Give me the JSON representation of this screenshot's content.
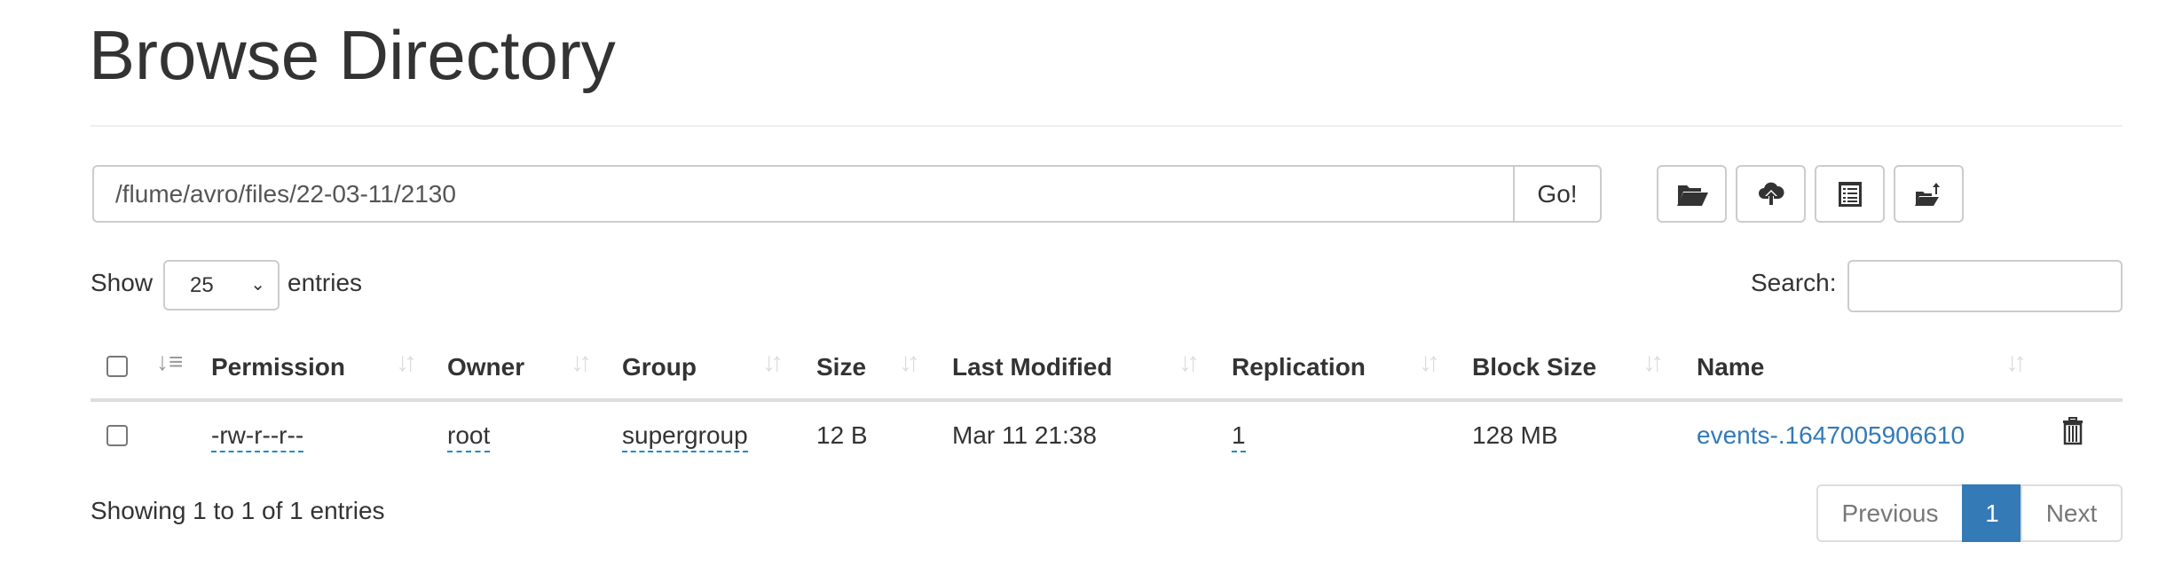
{
  "page_title": "Browse Directory",
  "path": {
    "value": "/flume/avro/files/22-03-11/2130",
    "go_label": "Go!"
  },
  "toolbar": {
    "icons": [
      "folder-open-icon",
      "cloud-upload-icon",
      "list-alt-icon",
      "folder-upload-icon"
    ]
  },
  "length": {
    "show_label": "Show",
    "selected": "25",
    "entries_label": "entries"
  },
  "search": {
    "label": "Search:",
    "value": ""
  },
  "table": {
    "headers": [
      "Permission",
      "Owner",
      "Group",
      "Size",
      "Last Modified",
      "Replication",
      "Block Size",
      "Name"
    ],
    "rows": [
      {
        "permission": "-rw-r--r--",
        "owner": "root",
        "group": "supergroup",
        "size": "12 B",
        "last_modified": "Mar 11 21:38",
        "replication": "1",
        "block_size": "128 MB",
        "name": "events-.1647005906610"
      }
    ]
  },
  "footer": {
    "info": "Showing 1 to 1 of 1 entries"
  },
  "pagination": {
    "previous": "Previous",
    "current": "1",
    "next": "Next"
  },
  "colors": {
    "accent": "#337ab7",
    "text": "#333333",
    "border": "#cccccc"
  }
}
